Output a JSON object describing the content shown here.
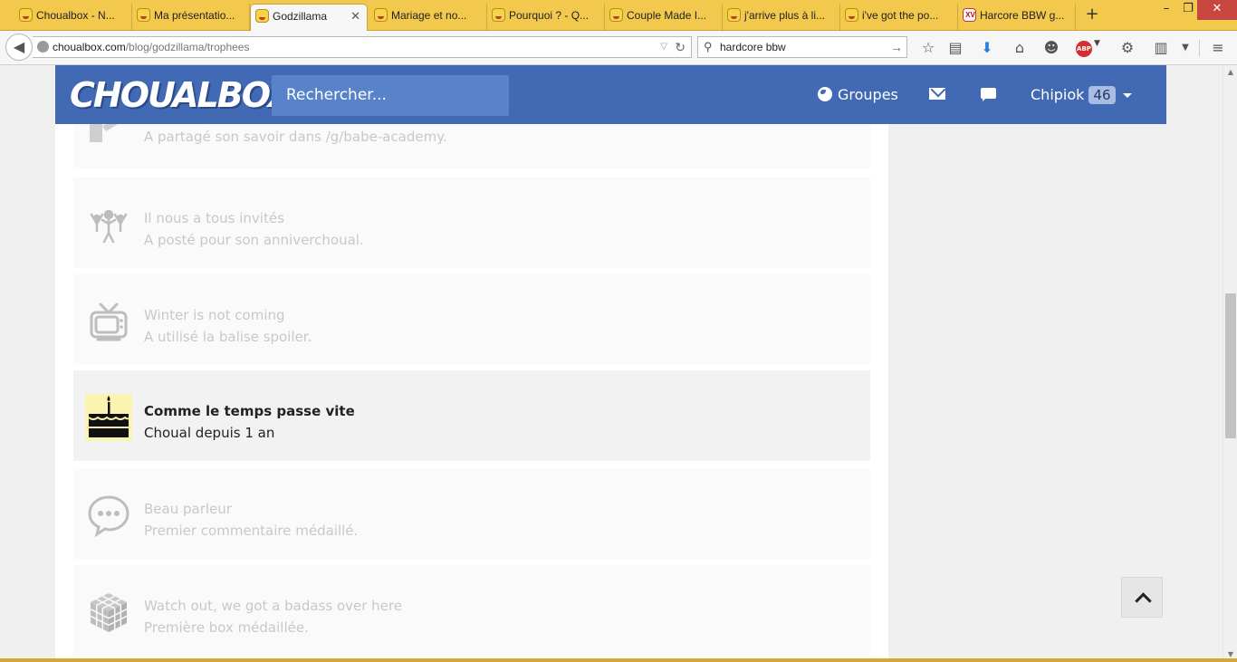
{
  "browser": {
    "tabs": [
      {
        "title": "Choualbox - N..."
      },
      {
        "title": "Ma présentatio..."
      },
      {
        "title": "Godzillama",
        "close": "✕"
      },
      {
        "title": "Mariage et no..."
      },
      {
        "title": "Pourquoi ? - Q..."
      },
      {
        "title": "Couple Made I..."
      },
      {
        "title": "j'arrive plus à li..."
      },
      {
        "title": "i've got the po..."
      },
      {
        "title": "Harcore BBW g..."
      }
    ],
    "new_tab": "+",
    "url_host": "choualbox.com",
    "url_path": "/blog/godzillama/trophees",
    "search_value": "hardcore bbw"
  },
  "header": {
    "logo": "CHOUALBOX",
    "search_placeholder": "Rechercher...",
    "groups_label": "Groupes",
    "user_name": "Chipiok",
    "user_badge": "46"
  },
  "trophies": [
    {
      "title": "",
      "desc": "A partagé son savoir dans /g/babe-academy.",
      "icon": "teacher-icon",
      "unlocked": false
    },
    {
      "title": "Il nous a tous invités",
      "desc": "A posté pour son anniverchoual.",
      "icon": "crowd-icon",
      "unlocked": false
    },
    {
      "title": "Winter is not coming",
      "desc": "A utilisé la balise spoiler.",
      "icon": "tv-icon",
      "unlocked": false
    },
    {
      "title": "Comme le temps passe vite",
      "desc": "Choual depuis 1 an",
      "icon": "cake-icon",
      "unlocked": true
    },
    {
      "title": "Beau parleur",
      "desc": "Premier commentaire médaillé.",
      "icon": "speech-bubble-icon",
      "unlocked": false
    },
    {
      "title": "Watch out, we got a badass over here",
      "desc": "Première box médaillée.",
      "icon": "cube-icon",
      "unlocked": false
    }
  ],
  "colors": {
    "header": "#4169b4",
    "search": "#5882c9",
    "tabbar": "#f2c94c",
    "locked_text": "#c8c8c8"
  }
}
